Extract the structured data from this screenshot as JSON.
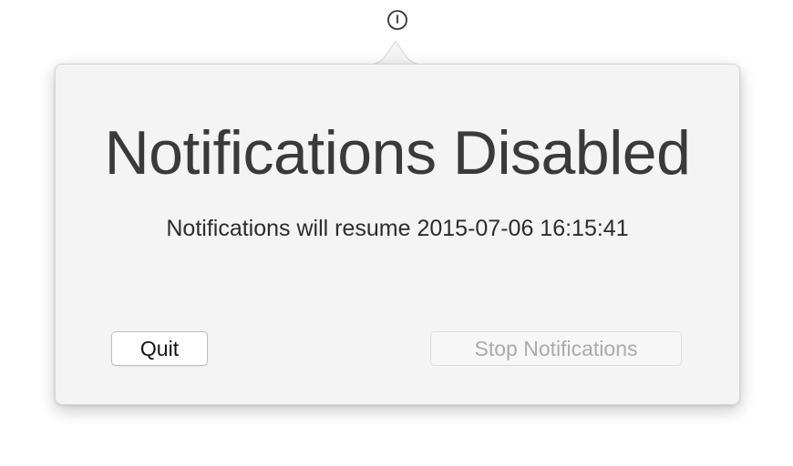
{
  "menubar": {
    "icon": "power-timer-icon"
  },
  "popover": {
    "title": "Notifications Disabled",
    "subtitle": "Notifications will resume 2015-07-06 16:15:41",
    "buttons": {
      "quit_label": "Quit",
      "stop_label": "Stop Notifications",
      "stop_enabled": false
    }
  },
  "colors": {
    "popover_background": "#f4f4f4",
    "title_text": "#3a3a3a",
    "disabled_text": "#aaaaaa"
  }
}
